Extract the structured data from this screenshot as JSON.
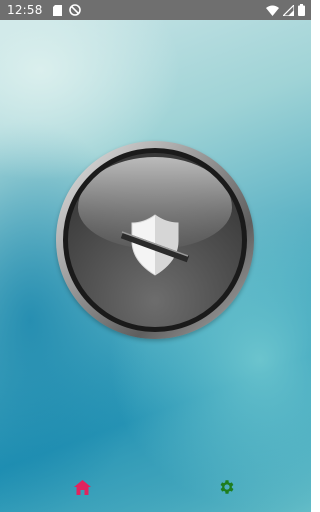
{
  "status_bar": {
    "time": "12:58",
    "icons": [
      "sd-card-icon",
      "do-not-disturb-icon",
      "wifi-icon",
      "signal-icon",
      "battery-icon"
    ]
  },
  "main": {
    "toggle_button": {
      "icon": "shield-off-icon",
      "state": "off"
    }
  },
  "bottom_nav": {
    "items": [
      {
        "icon": "home-icon",
        "color": "#e0245e"
      },
      {
        "icon": "gear-icon",
        "color": "#1e7d1e"
      }
    ]
  },
  "colors": {
    "status_bar": "#6f6f6f",
    "home_accent": "#e0245e",
    "settings_accent": "#1e7d1e"
  }
}
